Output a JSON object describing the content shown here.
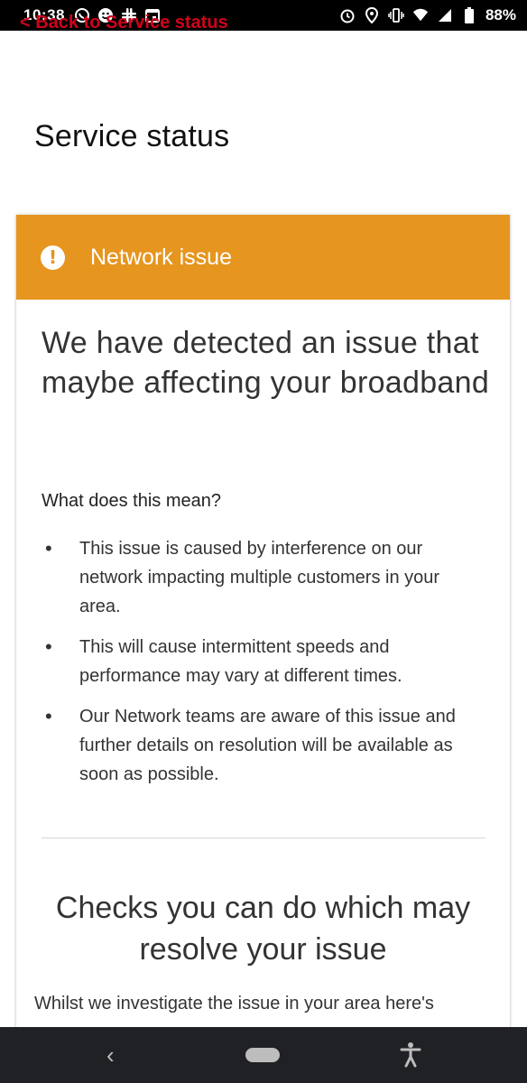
{
  "status_bar": {
    "time": "10:38",
    "battery": "88%",
    "left_icons": [
      "whatsapp-icon",
      "smiley-icon",
      "slack-icon",
      "calendar-icon"
    ],
    "right_icons": [
      "alarm-icon",
      "location-icon",
      "vibrate-icon",
      "wifi-icon",
      "signal-icon",
      "battery-icon"
    ]
  },
  "back_link": {
    "label": "< Back to Service status"
  },
  "page": {
    "title": "Service status"
  },
  "alert": {
    "label": "Network issue",
    "color": "#e6951f",
    "icon": "exclamation-circle-icon"
  },
  "issue": {
    "headline": "We have detected an issue that maybe affecting your broadband",
    "subheading": "What does this mean?",
    "bullets": [
      "This issue is caused by interference on our network impacting multiple customers in your area.",
      "This will cause intermittent speeds and performance may vary at different times.",
      "Our Network teams are aware of this issue and further details on resolution will be available as soon as possible."
    ]
  },
  "checks": {
    "title": "Checks you can do which may resolve your issue",
    "intro": "Whilst we investigate the issue in your area here's"
  },
  "nav_bar": {
    "back_icon": "chevron-left-icon",
    "home_icon": "home-pill-icon",
    "accessibility_icon": "accessibility-icon"
  }
}
